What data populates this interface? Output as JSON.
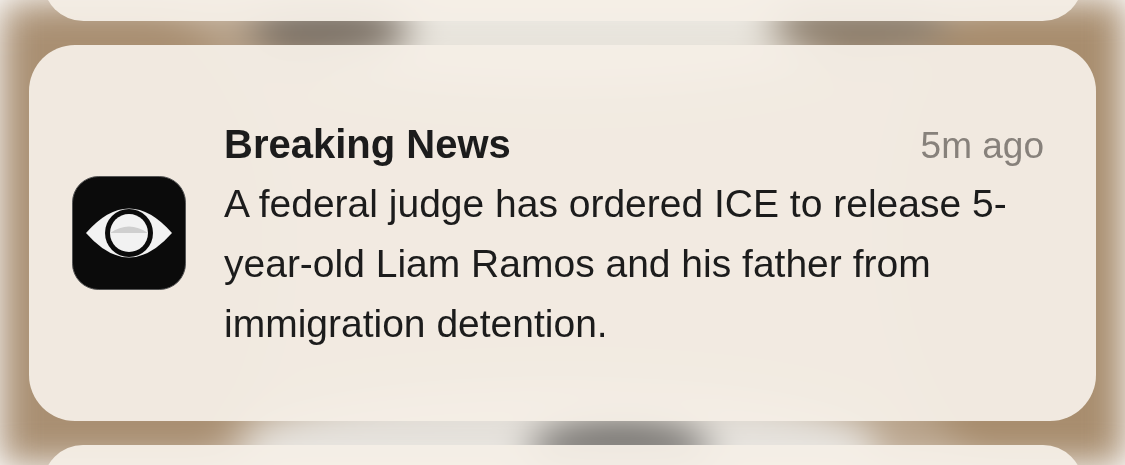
{
  "notification": {
    "title": "Breaking News",
    "time": "5m ago",
    "body": "A federal judge has ordered ICE to release 5-year-old Liam Ramos and his father from immigration detention."
  }
}
